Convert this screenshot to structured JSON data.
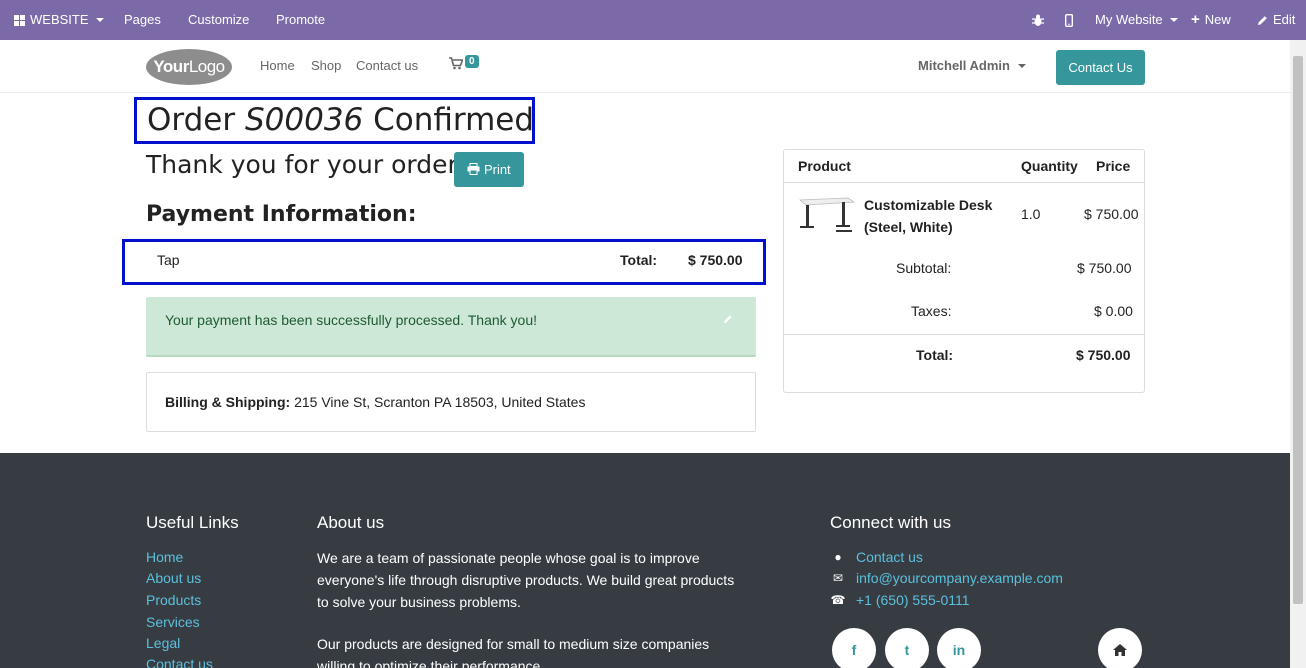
{
  "admin_bar": {
    "apps_label": "WEBSITE",
    "pages": "Pages",
    "customize": "Customize",
    "promote": "Promote",
    "my_website": "My Website",
    "new": "New",
    "edit": "Edit"
  },
  "header": {
    "logo_bold": "Your",
    "logo_light": "Logo",
    "nav": [
      "Home",
      "Shop",
      "Contact us"
    ],
    "cart_count": "0",
    "user": "Mitchell Admin",
    "contact_button": "Contact Us"
  },
  "order": {
    "title_prefix": "Order",
    "order_id": "S00036",
    "title_suffix": "Confirmed",
    "thanks": "Thank you for your order.",
    "print_label": "Print",
    "payment_heading": "Payment Information:",
    "payment_method": "Tap",
    "total_label": "Total:",
    "total_value": "$ 750.00",
    "alert_message": "Your payment has been successfully processed. Thank you!",
    "billing_label": "Billing & Shipping:",
    "billing_address": "215 Vine St, Scranton PA 18503, United States"
  },
  "summary": {
    "headers": [
      "Product",
      "Quantity",
      "Price"
    ],
    "product_name": "Customizable Desk (Steel, White)",
    "quantity": "1.0",
    "price": "$ 750.00",
    "subtotal_label": "Subtotal:",
    "subtotal_value": "$ 750.00",
    "taxes_label": "Taxes:",
    "taxes_value": "$ 0.00",
    "total_label": "Total:",
    "total_value": "$ 750.00"
  },
  "footer": {
    "useful_links_heading": "Useful Links",
    "useful_links": [
      "Home",
      "About us",
      "Products",
      "Services",
      "Legal",
      "Contact us"
    ],
    "about_heading": "About us",
    "about_p1": "We are a team of passionate people whose goal is to improve everyone's life through disruptive products. We build great products to solve your business problems.",
    "about_p2": "Our products are designed for small to medium size companies willing to optimize their performance.",
    "connect_heading": "Connect with us",
    "connect_contact": "Contact us",
    "connect_email": "info@yourcompany.example.com",
    "connect_phone": "+1 (650) 555-0111",
    "social": [
      "f",
      "t",
      "in",
      "home"
    ]
  },
  "colors": {
    "admin_bar": "#7c6aa8",
    "accent": "#35979c",
    "highlight_border": "#0011cc",
    "success_bg": "#cde8d6",
    "footer_bg": "#373c43",
    "footer_link": "#5bc0de"
  }
}
